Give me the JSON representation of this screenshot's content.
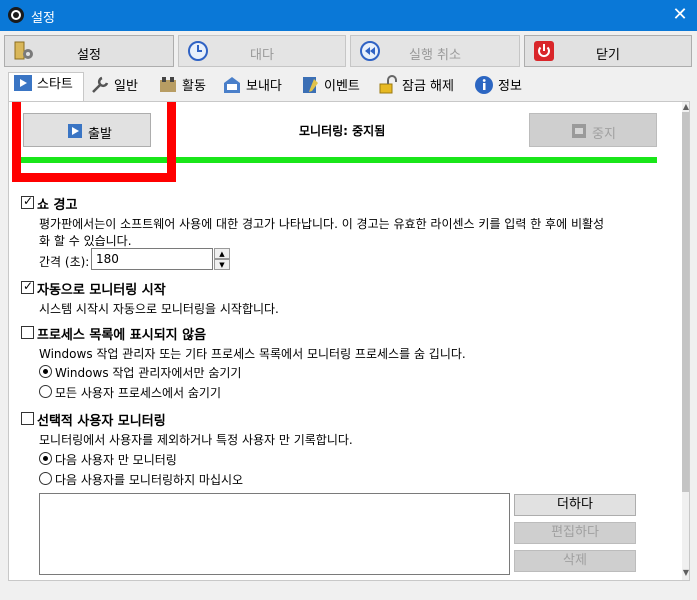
{
  "window": {
    "title": "설정",
    "close_glyph": "✕"
  },
  "toolbar": {
    "settings_label": "설정",
    "wait_label": "대다",
    "undo_label": "실행 취소",
    "close_label": "닫기"
  },
  "tabs": [
    {
      "label": "스타트",
      "icon": "play-icon"
    },
    {
      "label": "일반",
      "icon": "wrench-icon"
    },
    {
      "label": "활동",
      "icon": "activity-icon"
    },
    {
      "label": "보내다",
      "icon": "mailbox-icon"
    },
    {
      "label": "이벤트",
      "icon": "event-icon"
    },
    {
      "label": "잠금 해제",
      "icon": "unlock-icon"
    },
    {
      "label": "정보",
      "icon": "info-icon"
    }
  ],
  "monitor": {
    "start_label": "출발",
    "status_text": "모니터링: 중지됨",
    "stop_label": "중지",
    "progress": 1.0
  },
  "warning": {
    "title": "쇼 경고",
    "checked": true,
    "description_line1": "평가판에서는이 소프트웨어 사용에 대한 경고가 나타납니다. 이 경고는 유효한 라이센스 키를 입력 한 후에 비활성",
    "description_line2": "화 할 수 있습니다.",
    "interval_label": "간격 (초):",
    "interval_value": "180"
  },
  "autostart": {
    "title": "자동으로 모니터링 시작",
    "checked": true,
    "description": "시스템 시작시 자동으로 모니터링을 시작합니다."
  },
  "hide_process": {
    "title": "프로세스 목록에 표시되지 않음",
    "checked": false,
    "description": "Windows 작업 관리자 또는 기타 프로세스 목록에서 모니터링 프로세스를 숨 깁니다.",
    "option1": "Windows 작업 관리자에서만 숨기기",
    "option2": "모든 사용자 프로세스에서 숨기기",
    "selected": 1
  },
  "selective_user": {
    "title": "선택적 사용자 모니터링",
    "checked": false,
    "description": "모니터링에서 사용자를 제외하거나 특정 사용자 만 기록합니다.",
    "option1": "다음 사용자 만 모니터링",
    "option2": "다음 사용자를 모니터링하지 마십시오",
    "selected": 1,
    "add_label": "더하다",
    "edit_label": "편집하다",
    "delete_label": "삭제"
  },
  "colors": {
    "titlebar": "#0a78d7",
    "progress": "#19e619",
    "highlight": "#ff0000"
  }
}
